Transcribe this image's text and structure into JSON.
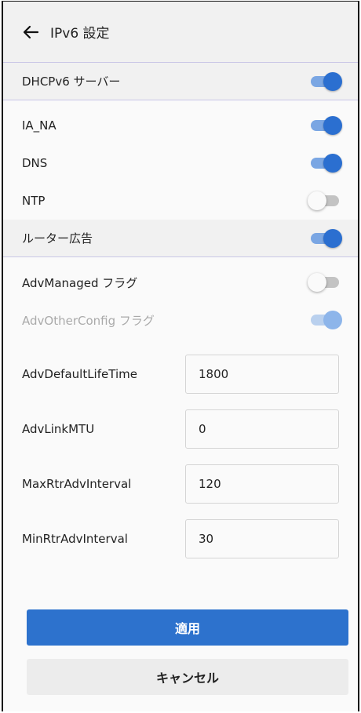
{
  "header": {
    "title": "IPv6 設定",
    "back_icon": "arrow-left-icon"
  },
  "dhcpv6": {
    "label": "DHCPv6 サーバー",
    "enabled": true,
    "items": [
      {
        "label": "IA_NA",
        "enabled": true
      },
      {
        "label": "DNS",
        "enabled": true
      },
      {
        "label": "NTP",
        "enabled": false
      }
    ]
  },
  "ra": {
    "label": "ルーター広告",
    "enabled": true,
    "adv_managed": {
      "label": "AdvManaged フラグ",
      "enabled": false
    },
    "adv_other": {
      "label": "AdvOtherConfig フラグ",
      "enabled": true,
      "disabled": true
    }
  },
  "fields": [
    {
      "label": "AdvDefaultLifeTime",
      "value": "1800"
    },
    {
      "label": "AdvLinkMTU",
      "value": "0"
    },
    {
      "label": "MaxRtrAdvInterval",
      "value": "120"
    },
    {
      "label": "MinRtrAdvInterval",
      "value": "30"
    }
  ],
  "actions": {
    "apply_label": "適用",
    "cancel_label": "キャンセル"
  },
  "colors": {
    "accent": "#2d72cd",
    "thumb_on": "#2b6fd0",
    "track_on": "#7aa6e3",
    "divider": "#c9c6e6"
  }
}
